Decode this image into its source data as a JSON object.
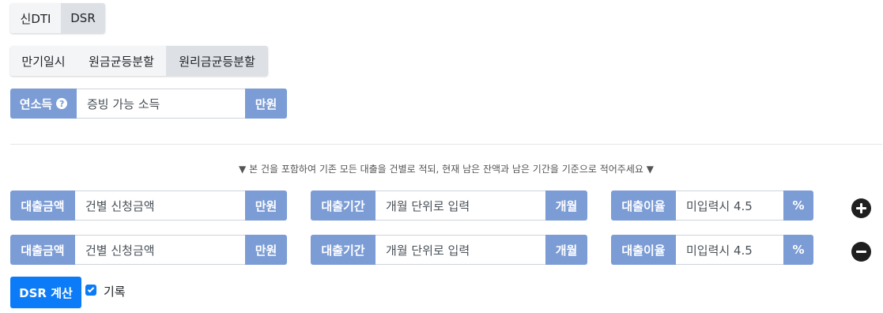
{
  "ratio_tabs": [
    "신DTI",
    "DSR"
  ],
  "repay_tabs": [
    "만기일시",
    "원금균등분할",
    "원리금균등분할"
  ],
  "income": {
    "label": "연소득",
    "placeholder": "증빙 가능 소득",
    "unit": "만원",
    "help_icon": "question-circle-icon"
  },
  "notice": "▼ 본 건을 포함하여 기존 모든 대출을 건별로 적되, 현재 남은 잔액과 남은 기간을 기준으로 적어주세요 ▼",
  "loan_rows": [
    {
      "amount": {
        "label": "대출금액",
        "placeholder": "건별 신청금액",
        "unit": "만원"
      },
      "period": {
        "label": "대출기간",
        "placeholder": "개월 단위로 입력",
        "unit": "개월"
      },
      "rate": {
        "label": "대출이율",
        "placeholder": "미입력시 4.5",
        "unit": "%"
      },
      "action": "plus-circle-icon"
    },
    {
      "amount": {
        "label": "대출금액",
        "placeholder": "건별 신청금액",
        "unit": "만원"
      },
      "period": {
        "label": "대출기간",
        "placeholder": "개월 단위로 입력",
        "unit": "개월"
      },
      "rate": {
        "label": "대출이율",
        "placeholder": "미입력시 4.5",
        "unit": "%"
      },
      "action": "minus-circle-icon"
    }
  ],
  "calc_button": "DSR 계산",
  "record_label": "기록",
  "colors": {
    "label_bg": "#7b9cd5",
    "primary": "#0b7bf7",
    "tab_active": "#dde0e5",
    "tab_bg": "#f4f5f7"
  }
}
